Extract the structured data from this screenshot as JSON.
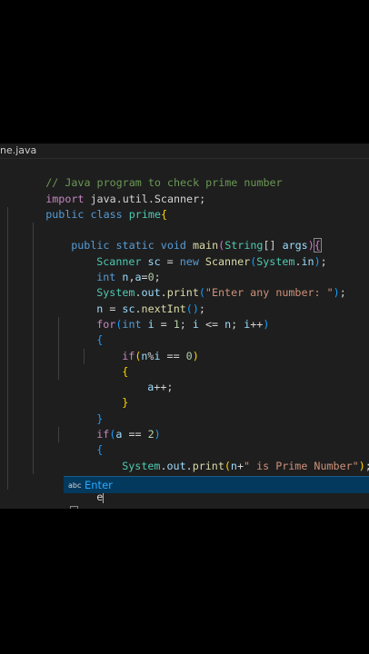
{
  "editor": {
    "tab_label": "ne.java",
    "cursor_line_text": "e",
    "lines": [
      "// Java program to check prime number",
      "import java.util.Scanner;",
      "public class prime{",
      "public static void main(String[] args){",
      "Scanner sc = new Scanner(System.in);",
      "int n,a=0;",
      "System.out.print(\"Enter any number: \");",
      "n = sc.nextInt();",
      "for(int i = 1; i <= n; i++)",
      "{",
      "if(n%i == 0)",
      "{",
      "a++;",
      "}",
      "}",
      "if(a == 2)",
      "{",
      "System.out.print(n+\" is Prime Number\");",
      "}",
      "e",
      "}",
      "}"
    ]
  },
  "suggest": {
    "icon": "abc",
    "label": "Enter"
  }
}
